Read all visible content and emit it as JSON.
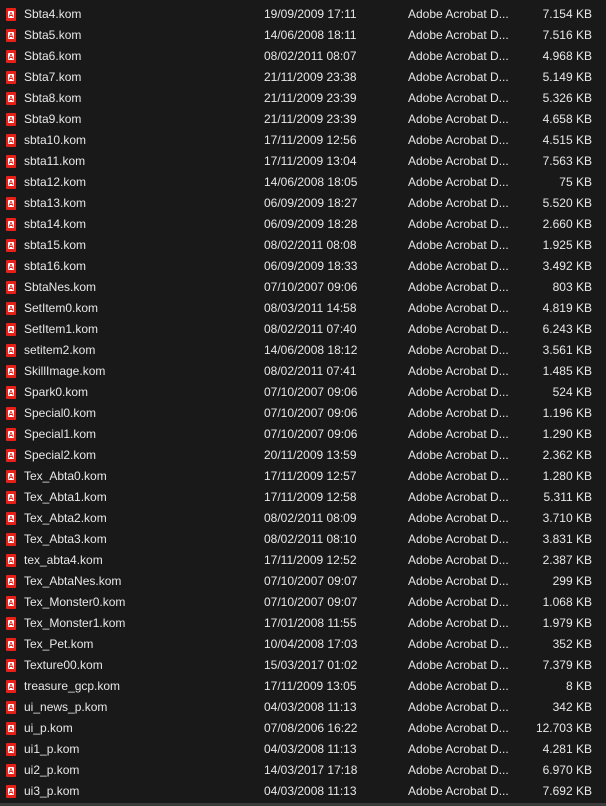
{
  "file_type_label": "Adobe Acrobat D...",
  "icon": "pdf-file-icon",
  "accent_color": "#e8201a",
  "files": [
    {
      "name": "Sbta4.kom",
      "date": "19/09/2009 17:11",
      "size": "7.154 KB"
    },
    {
      "name": "Sbta5.kom",
      "date": "14/06/2008 18:11",
      "size": "7.516 KB"
    },
    {
      "name": "Sbta6.kom",
      "date": "08/02/2011 08:07",
      "size": "4.968 KB"
    },
    {
      "name": "Sbta7.kom",
      "date": "21/11/2009 23:38",
      "size": "5.149 KB"
    },
    {
      "name": "Sbta8.kom",
      "date": "21/11/2009 23:39",
      "size": "5.326 KB"
    },
    {
      "name": "Sbta9.kom",
      "date": "21/11/2009 23:39",
      "size": "4.658 KB"
    },
    {
      "name": "sbta10.kom",
      "date": "17/11/2009 12:56",
      "size": "4.515 KB"
    },
    {
      "name": "sbta11.kom",
      "date": "17/11/2009 13:04",
      "size": "7.563 KB"
    },
    {
      "name": "sbta12.kom",
      "date": "14/06/2008 18:05",
      "size": "75 KB"
    },
    {
      "name": "sbta13.kom",
      "date": "06/09/2009 18:27",
      "size": "5.520 KB"
    },
    {
      "name": "sbta14.kom",
      "date": "06/09/2009 18:28",
      "size": "2.660 KB"
    },
    {
      "name": "sbta15.kom",
      "date": "08/02/2011 08:08",
      "size": "1.925 KB"
    },
    {
      "name": "sbta16.kom",
      "date": "06/09/2009 18:33",
      "size": "3.492 KB"
    },
    {
      "name": "SbtaNes.kom",
      "date": "07/10/2007 09:06",
      "size": "803 KB"
    },
    {
      "name": "SetItem0.kom",
      "date": "08/03/2011 14:58",
      "size": "4.819 KB"
    },
    {
      "name": "SetItem1.kom",
      "date": "08/02/2011 07:40",
      "size": "6.243 KB"
    },
    {
      "name": "setitem2.kom",
      "date": "14/06/2008 18:12",
      "size": "3.561 KB"
    },
    {
      "name": "SkillImage.kom",
      "date": "08/02/2011 07:41",
      "size": "1.485 KB"
    },
    {
      "name": "Spark0.kom",
      "date": "07/10/2007 09:06",
      "size": "524 KB"
    },
    {
      "name": "Special0.kom",
      "date": "07/10/2007 09:06",
      "size": "1.196 KB"
    },
    {
      "name": "Special1.kom",
      "date": "07/10/2007 09:06",
      "size": "1.290 KB"
    },
    {
      "name": "Special2.kom",
      "date": "20/11/2009 13:59",
      "size": "2.362 KB"
    },
    {
      "name": "Tex_Abta0.kom",
      "date": "17/11/2009 12:57",
      "size": "1.280 KB"
    },
    {
      "name": "Tex_Abta1.kom",
      "date": "17/11/2009 12:58",
      "size": "5.311 KB"
    },
    {
      "name": "Tex_Abta2.kom",
      "date": "08/02/2011 08:09",
      "size": "3.710 KB"
    },
    {
      "name": "Tex_Abta3.kom",
      "date": "08/02/2011 08:10",
      "size": "3.831 KB"
    },
    {
      "name": "tex_abta4.kom",
      "date": "17/11/2009 12:52",
      "size": "2.387 KB"
    },
    {
      "name": "Tex_AbtaNes.kom",
      "date": "07/10/2007 09:07",
      "size": "299 KB"
    },
    {
      "name": "Tex_Monster0.kom",
      "date": "07/10/2007 09:07",
      "size": "1.068 KB"
    },
    {
      "name": "Tex_Monster1.kom",
      "date": "17/01/2008 11:55",
      "size": "1.979 KB"
    },
    {
      "name": "Tex_Pet.kom",
      "date": "10/04/2008 17:03",
      "size": "352 KB"
    },
    {
      "name": "Texture00.kom",
      "date": "15/03/2017 01:02",
      "size": "7.379 KB"
    },
    {
      "name": "treasure_gcp.kom",
      "date": "17/11/2009 13:05",
      "size": "8 KB"
    },
    {
      "name": "ui_news_p.kom",
      "date": "04/03/2008 11:13",
      "size": "342 KB"
    },
    {
      "name": "ui_p.kom",
      "date": "07/08/2006 16:22",
      "size": "12.703 KB"
    },
    {
      "name": "ui1_p.kom",
      "date": "04/03/2008 11:13",
      "size": "4.281 KB"
    },
    {
      "name": "ui2_p.kom",
      "date": "14/03/2017 17:18",
      "size": "6.970 KB"
    },
    {
      "name": "ui3_p.kom",
      "date": "04/03/2008 11:13",
      "size": "7.692 KB"
    }
  ]
}
